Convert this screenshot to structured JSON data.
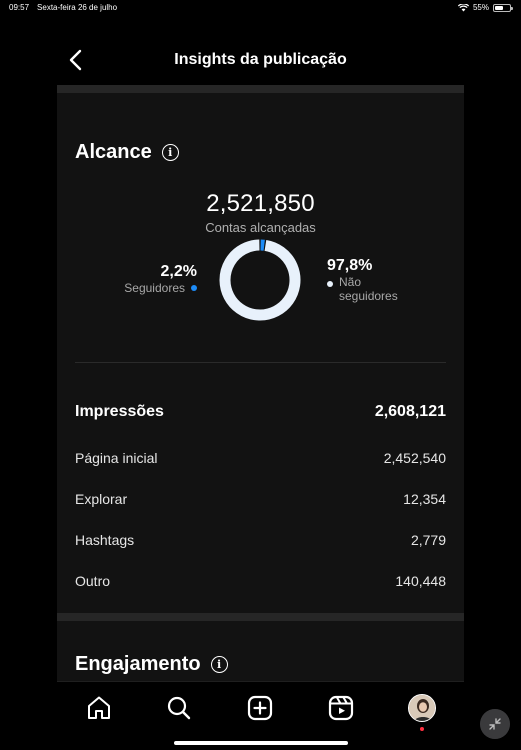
{
  "status_bar": {
    "time": "09:57",
    "date": "Sexta-feira 26 de julho",
    "battery": "55%",
    "battery_level": 0.55,
    "icons": [
      "wifi-icon",
      "battery-icon"
    ]
  },
  "header": {
    "title": "Insights da publicação",
    "back_icon": "chevron-left-icon"
  },
  "reach": {
    "title": "Alcance",
    "info_icon": "info-icon",
    "accounts_reached": "2,521,850",
    "accounts_reached_label": "Contas alcançadas",
    "segments": [
      {
        "percent": "2,2%",
        "label": "Seguidores",
        "value": 2.2,
        "color": "#1d8cf8"
      },
      {
        "percent": "97,8%",
        "label_line1": "Não",
        "label_line2": "seguidores",
        "value": 97.8,
        "color": "#e8f1fb"
      }
    ],
    "impressions_label": "Impressões",
    "impressions_total": "2,608,121",
    "sources": [
      {
        "label": "Página inicial",
        "value": "2,452,540"
      },
      {
        "label": "Explorar",
        "value": "12,354"
      },
      {
        "label": "Hashtags",
        "value": "2,779"
      },
      {
        "label": "Outro",
        "value": "140,448"
      }
    ]
  },
  "engagement": {
    "title": "Engajamento",
    "info_icon": "info-icon"
  },
  "tabbar": {
    "items": [
      "home-icon",
      "search-icon",
      "create-icon",
      "reels-icon",
      "profile-avatar"
    ],
    "notification_color": "#ff3040"
  },
  "overlay": {
    "collapse_icon": "collapse-icon"
  }
}
